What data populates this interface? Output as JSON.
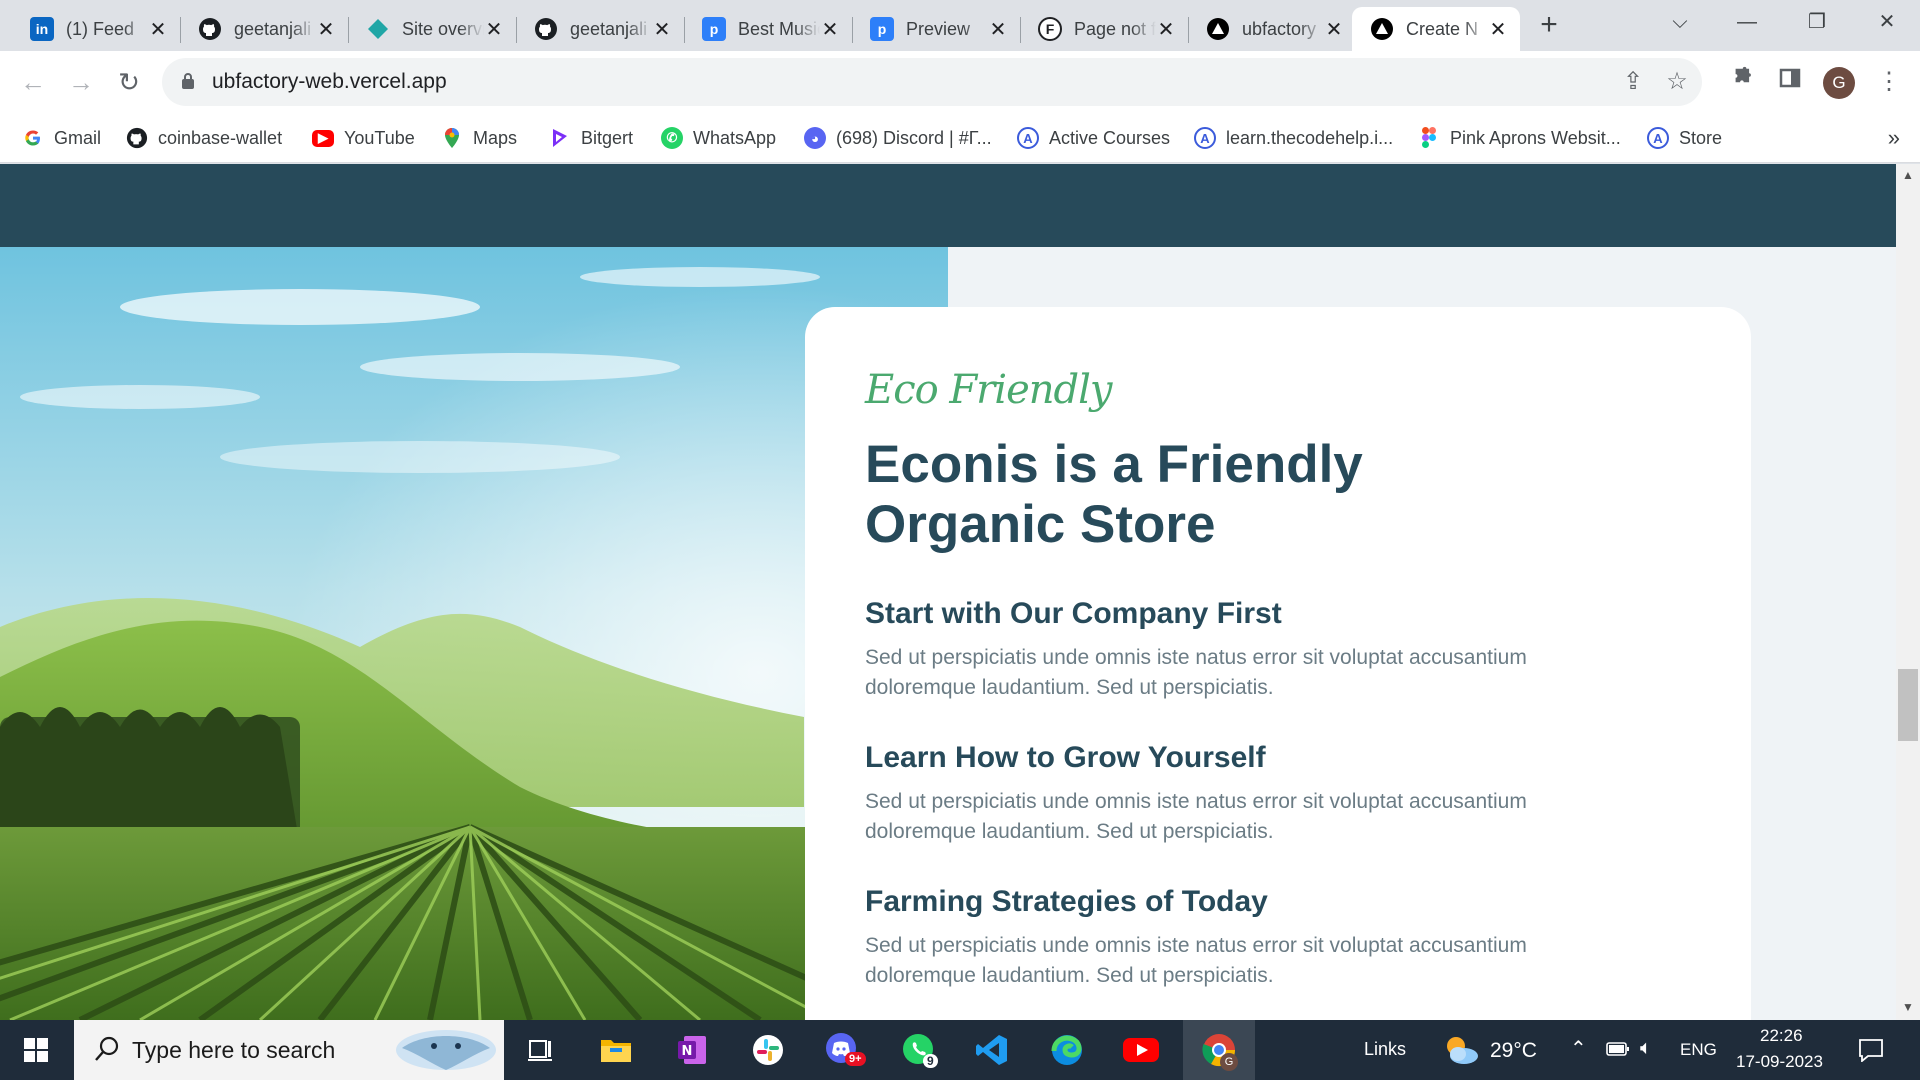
{
  "tabs": [
    {
      "title": "(1) Feed",
      "icon": "linkedin-icon"
    },
    {
      "title": "geetanjali",
      "icon": "github-icon"
    },
    {
      "title": "Site overview",
      "icon": "netlify-icon"
    },
    {
      "title": "geetanjali",
      "icon": "github-icon"
    },
    {
      "title": "Best Music",
      "icon": "p-icon"
    },
    {
      "title": "Preview",
      "icon": "p-icon"
    },
    {
      "title": "Page not found",
      "icon": "f-icon"
    },
    {
      "title": "ubfactory",
      "icon": "vercel-icon"
    },
    {
      "title": "Create N",
      "icon": "vercel-icon"
    }
  ],
  "address_bar": {
    "url": "ubfactory-web.vercel.app"
  },
  "profile_initial": "G",
  "bookmarks": [
    {
      "label": "Gmail",
      "icon": "google-icon"
    },
    {
      "label": "coinbase-wallet",
      "icon": "github-icon"
    },
    {
      "label": "YouTube",
      "icon": "youtube-icon"
    },
    {
      "label": "Maps",
      "icon": "maps-icon"
    },
    {
      "label": "Bitgert",
      "icon": "bitgert-icon"
    },
    {
      "label": "WhatsApp",
      "icon": "whatsapp-icon"
    },
    {
      "label": "(698) Discord | #Γ...",
      "icon": "discord-icon"
    },
    {
      "label": "Active Courses",
      "icon": "codehelp-icon"
    },
    {
      "label": "learn.thecodehelp.i...",
      "icon": "codehelp-icon"
    },
    {
      "label": "Pink Aprons Websit...",
      "icon": "figma-icon"
    },
    {
      "label": "Store",
      "icon": "codehelp-icon"
    }
  ],
  "page": {
    "eyebrow": "Eco Friendly",
    "headline": "Econis is a Friendly Organic Store",
    "features": [
      {
        "title": "Start with Our Company First",
        "text": "Sed ut perspiciatis unde omnis iste natus error sit voluptat accusantium doloremque laudantium. Sed ut perspiciatis."
      },
      {
        "title": "Learn How to Grow Yourself",
        "text": "Sed ut perspiciatis unde omnis iste natus error sit voluptat accusantium doloremque laudantium. Sed ut perspiciatis."
      },
      {
        "title": "Farming Strategies of Today",
        "text": "Sed ut perspiciatis unde omnis iste natus error sit voluptat accusantium doloremque laudantium. Sed ut perspiciatis."
      }
    ]
  },
  "taskbar": {
    "search_placeholder": "Type here to search",
    "whatsapp_badge": "9",
    "discord_badge": "9+",
    "links_label": "Links",
    "temperature": "29°C",
    "language": "ENG",
    "time": "22:26",
    "date": "17-09-2023"
  },
  "colors": {
    "header_band": "#274a5a",
    "heading": "#274a5a",
    "accent_green": "#4ba96f",
    "body_text": "#6b7c85",
    "page_bg": "#eff3f6"
  }
}
